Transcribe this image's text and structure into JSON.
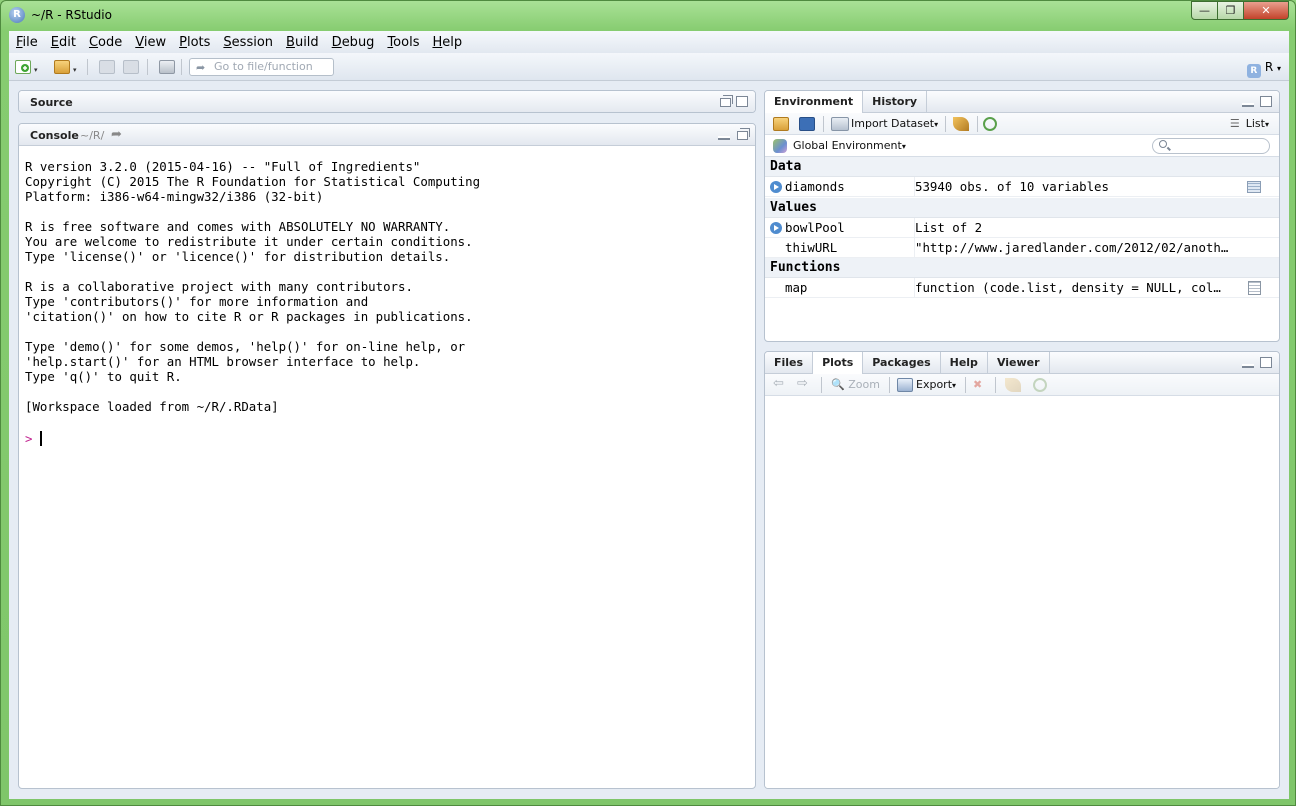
{
  "window": {
    "title": "~/R - RStudio",
    "app_icon_letter": "R",
    "minimize": "—",
    "maximize": "❐",
    "close": "✕"
  },
  "menubar": {
    "items": [
      "File",
      "Edit",
      "Code",
      "View",
      "Plots",
      "Session",
      "Build",
      "Debug",
      "Tools",
      "Help"
    ]
  },
  "toolbar": {
    "goto_placeholder": "Go to file/function",
    "project_label": "R",
    "project_icon_letter": "R",
    "icons": [
      "new-file-icon",
      "open-folder-icon",
      "save-icon",
      "save-all-icon",
      "print-icon"
    ]
  },
  "source_pane": {
    "title": "Source"
  },
  "console_pane": {
    "title": "Console",
    "path": "~/R/",
    "lines": "R version 3.2.0 (2015-04-16) -- \"Full of Ingredients\"\nCopyright (C) 2015 The R Foundation for Statistical Computing\nPlatform: i386-w64-mingw32/i386 (32-bit)\n\nR is free software and comes with ABSOLUTELY NO WARRANTY.\nYou are welcome to redistribute it under certain conditions.\nType 'license()' or 'licence()' for distribution details.\n\nR is a collaborative project with many contributors.\nType 'contributors()' for more information and\n'citation()' on how to cite R or R packages in publications.\n\nType 'demo()' for some demos, 'help()' for on-line help, or\n'help.start()' for an HTML browser interface to help.\nType 'q()' to quit R.\n\n[Workspace loaded from ~/R/.RData]",
    "prompt": ">"
  },
  "environment_pane": {
    "tabs": [
      "Environment",
      "History"
    ],
    "active_tab": "Environment",
    "import_label": "Import Dataset",
    "view_mode": "List",
    "scope": "Global Environment",
    "sections": {
      "data": "Data",
      "values": "Values",
      "functions": "Functions"
    },
    "data_rows": [
      {
        "name": "diamonds",
        "value": "53940 obs. of 10 variables"
      }
    ],
    "value_rows": [
      {
        "name": "bowlPool",
        "value": "List of 2"
      },
      {
        "name": "thiwURL",
        "value": "\"http://www.jaredlander.com/2012/02/anoth…"
      }
    ],
    "function_rows": [
      {
        "name": "map",
        "value": "function (code.list, density = NULL, col…"
      }
    ]
  },
  "files_pane": {
    "tabs": [
      "Files",
      "Plots",
      "Packages",
      "Help",
      "Viewer"
    ],
    "active_tab": "Plots",
    "zoom_label": "Zoom",
    "export_label": "Export"
  },
  "colors": {
    "window_frame": "#86cc70",
    "client_bg": "#e6ecf4",
    "prompt": "#c1218f",
    "expand_dot": "#4f8ccf"
  }
}
